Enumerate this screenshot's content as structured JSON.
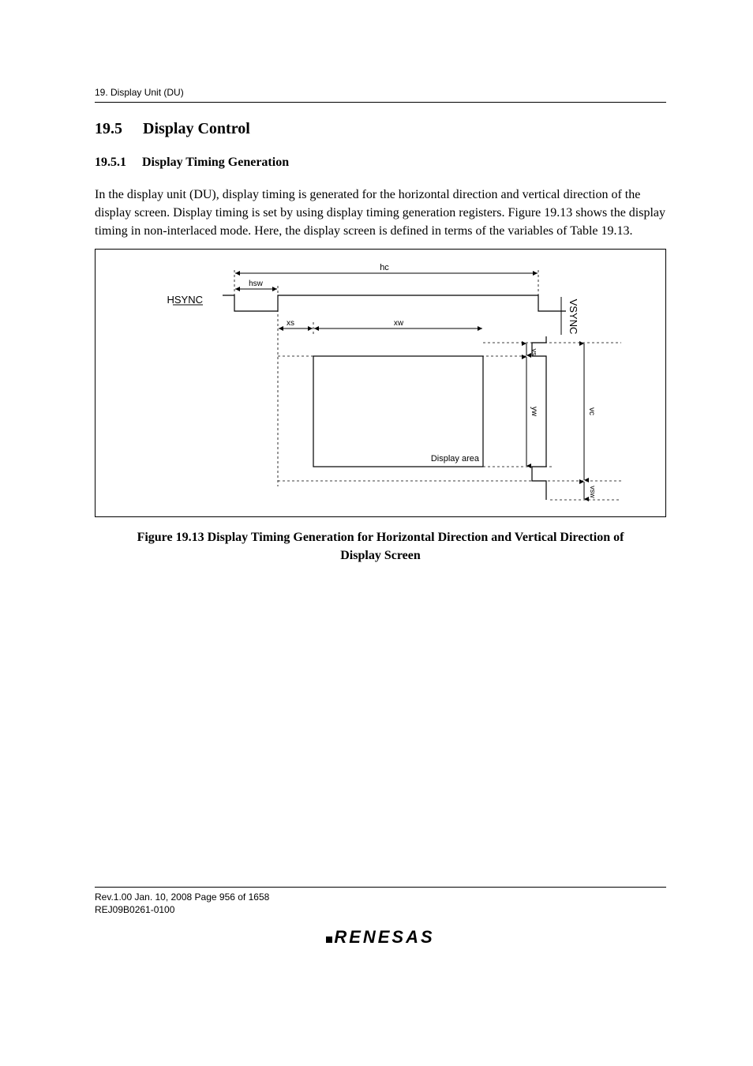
{
  "header": {
    "breadcrumb": "19.   Display Unit (DU)"
  },
  "section": {
    "num": "19.5",
    "title": "Display Control"
  },
  "subsection": {
    "num": "19.5.1",
    "title": "Display Timing Generation"
  },
  "paragraph": "In the display unit (DU), display timing is generated for the horizontal direction and vertical direction of the display screen. Display timing is set by using display timing generation registers. Figure 19.13 shows the display timing in non-interlaced mode. Here, the display screen is defined in terms of the variables of Table 19.13.",
  "figure": {
    "labels": {
      "hsync": "HSYNC",
      "vsync": "VSYNC",
      "hc": "hc",
      "hsw": "hsw",
      "xs": "xs",
      "xw": "xw",
      "vs": "vs",
      "yw": "yw",
      "vc": "vc",
      "vsw": "vsw",
      "display_area": "Display area"
    },
    "caption_line1": "Figure 19.13   Display Timing Generation for Horizontal Direction and Vertical Direction of",
    "caption_line2": "Display Screen"
  },
  "footer": {
    "rev": "Rev.1.00  Jan. 10, 2008  Page 956 of 1658",
    "doc": "REJ09B0261-0100",
    "logo": "RENESAS"
  }
}
